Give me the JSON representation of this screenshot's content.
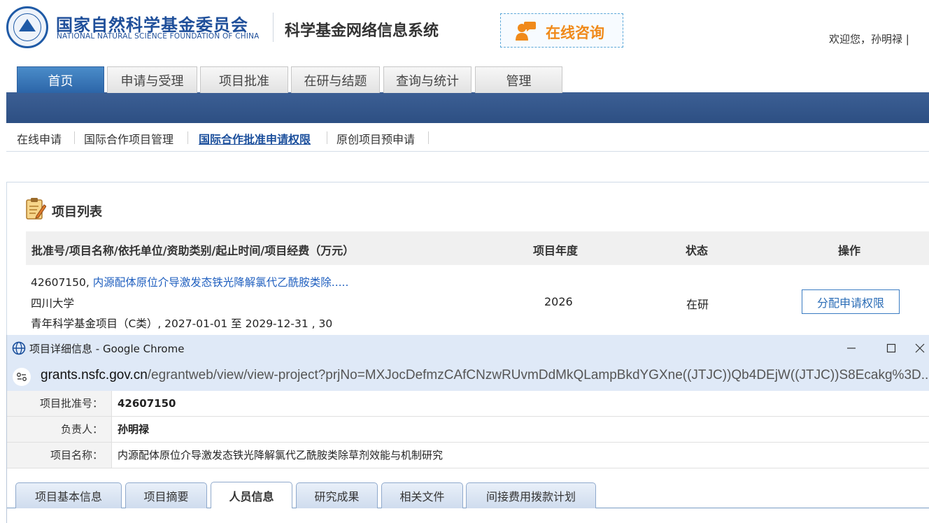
{
  "header": {
    "org_cn": "国家自然科学基金委员会",
    "org_en": "NATIONAL NATURAL SCIENCE FOUNDATION OF CHINA",
    "system_title": "科学基金网络信息系统",
    "consult_label": "在线咨询",
    "welcome": "欢迎您，孙明禄 |"
  },
  "main_nav": [
    "首页",
    "申请与受理",
    "项目批准",
    "在研与结题",
    "查询与统计",
    "管理"
  ],
  "sub_nav": [
    "在线申请",
    "国际合作项目管理",
    "国际合作批准申请权限",
    "原创项目预申请"
  ],
  "project_list": {
    "title": "项目列表",
    "columns": [
      "批准号/项目名称/依托单位/资助类别/起止时间/项目经费（万元）",
      "项目年度",
      "状态",
      "操作"
    ],
    "row": {
      "approval_no": "42607150,",
      "name_link": "内源配体原位介导激发态铁光降解氯代乙酰胺类除.....",
      "unit": "四川大学",
      "category_line": "青年科学基金项目（C类）, 2027-01-01 至 2029-12-31 , 30",
      "year": "2026",
      "status": "在研",
      "action": "分配申请权限"
    }
  },
  "popup": {
    "window_title": "项目详细信息 - Google Chrome",
    "url_domain": "grants.nsfc.gov.cn",
    "url_path": "/egrantweb/view/view-project?prjNo=MXJocDefmzCAfCNzwRUvmDdMkQLampBkdYGXne((JTJC))Qb4DEjW((JTJC))S8Ecakg%3D...",
    "fields": [
      {
        "label": "项目批准号：",
        "value": "42607150"
      },
      {
        "label": "负责人：",
        "value": "孙明禄"
      },
      {
        "label": "项目名称：",
        "value": "内源配体原位介导激发态铁光降解氯代乙酰胺类除草剂效能与机制研究"
      }
    ],
    "tabs": [
      "项目基本信息",
      "项目摘要",
      "人员信息",
      "研究成果",
      "相关文件",
      "间接费用拨款计划"
    ],
    "active_tab": "人员信息"
  },
  "colors": {
    "brand_blue": "#1f4f9a",
    "nav_band": "#2d4f83",
    "consult_orange": "#f08a1a",
    "link_blue": "#1f5fbf"
  }
}
